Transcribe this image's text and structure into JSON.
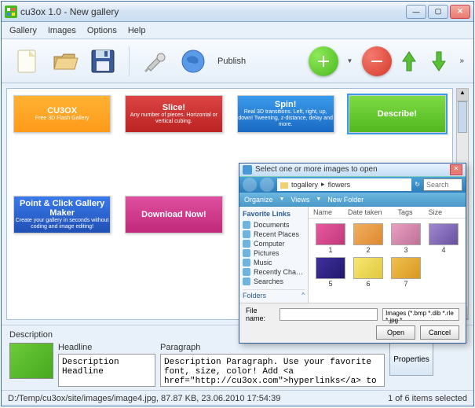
{
  "titlebar": {
    "title": "cu3ox 1.0 - New gallery"
  },
  "menu": {
    "gallery": "Gallery",
    "images": "Images",
    "options": "Options",
    "help": "Help"
  },
  "toolbar": {
    "publish": "Publish"
  },
  "thumbs": [
    {
      "title": "CU3OX",
      "sub": "Free 3D Flash Gallery",
      "bg": "linear-gradient(#ffb233,#ff9a1a)",
      "selected": false
    },
    {
      "title": "Slice!",
      "sub": "Any number of pieces. Horizontal or vertical cubing.",
      "bg": "linear-gradient(#d44,#b22)",
      "selected": false
    },
    {
      "title": "Spin!",
      "sub": "Real 3D transitions. Left, right, up, down! Tweening, z-distance, delay and more.",
      "bg": "linear-gradient(#3a9aeb,#1a6ac4)",
      "selected": false
    },
    {
      "title": "Describe!",
      "sub": "",
      "bg": "linear-gradient(#7ddb44,#52b820)",
      "selected": true
    },
    {
      "title": "Point & Click Gallery Maker",
      "sub": "Create your gallery in seconds without coding and image editing!",
      "bg": "linear-gradient(#3a7aeb,#2050b4)",
      "selected": false
    },
    {
      "title": "Download Now!",
      "sub": "",
      "bg": "linear-gradient(#e050a0,#c02878)",
      "selected": false
    }
  ],
  "desc": {
    "section": "Description",
    "headline_label": "Headline",
    "paragraph_label": "Paragraph",
    "headline": "Description Headline",
    "paragraph": "Description Paragraph. Use your favorite font, size, color! Add <a href=\"http://cu3ox.com\">hyperlinks</a> to text!",
    "properties_btn": "Properties"
  },
  "status": {
    "left": "D:/Temp/cu3ox/site/images/image4.jpg, 87.87 KB, 23.06.2010 17:54:39",
    "right": "1 of 6 items selected"
  },
  "dialog": {
    "title": "Select one or more images to open",
    "breadcrumb_parent": "togallery",
    "breadcrumb_current": "flowers",
    "search_placeholder": "Search",
    "organize": "Organize",
    "views": "Views",
    "newfolder": "New Folder",
    "fav_label": "Favorite Links",
    "side_items": [
      "Documents",
      "Recent Places",
      "Computer",
      "Pictures",
      "Music",
      "Recently Chan...",
      "Searches"
    ],
    "folders_label": "Folders",
    "cols": {
      "name": "Name",
      "date": "Date taken",
      "tags": "Tags",
      "size": "Size"
    },
    "files": [
      {
        "name": "1",
        "bg": "linear-gradient(135deg,#e85aa0,#c03878)"
      },
      {
        "name": "2",
        "bg": "linear-gradient(135deg,#f0b060,#e08830)"
      },
      {
        "name": "3",
        "bg": "linear-gradient(135deg,#e8a0c0,#c07098)"
      },
      {
        "name": "4",
        "bg": "linear-gradient(135deg,#a088d0,#6850a0)"
      },
      {
        "name": "5",
        "bg": "linear-gradient(135deg,#4030a0,#201868)"
      },
      {
        "name": "6",
        "bg": "linear-gradient(135deg,#f8e870,#e0c840)"
      },
      {
        "name": "7",
        "bg": "linear-gradient(135deg,#f0c050,#d89820)"
      }
    ],
    "filename_label": "File name:",
    "filename": "",
    "filter": "Images (*.bmp *.dib *.rle *.jpg *",
    "open": "Open",
    "cancel": "Cancel"
  }
}
